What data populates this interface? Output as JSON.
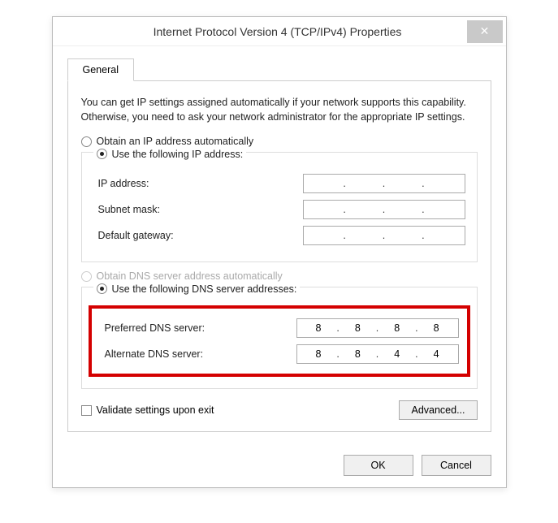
{
  "window": {
    "title": "Internet Protocol Version 4 (TCP/IPv4) Properties",
    "close_icon": "✕"
  },
  "tab": {
    "label": "General"
  },
  "info": "You can get IP settings assigned automatically if your network supports this capability. Otherwise, you need to ask your network administrator for the appropriate IP settings.",
  "ip": {
    "auto_label": "Obtain an IP address automatically",
    "manual_label": "Use the following IP address:",
    "address_label": "IP address:",
    "mask_label": "Subnet mask:",
    "gateway_label": "Default gateway:",
    "address": [
      "",
      "",
      "",
      ""
    ],
    "mask": [
      "",
      "",
      "",
      ""
    ],
    "gateway": [
      "",
      "",
      "",
      ""
    ]
  },
  "dns": {
    "auto_label": "Obtain DNS server address automatically",
    "manual_label": "Use the following DNS server addresses:",
    "preferred_label": "Preferred DNS server:",
    "alternate_label": "Alternate DNS server:",
    "preferred": [
      "8",
      "8",
      "8",
      "8"
    ],
    "alternate": [
      "8",
      "8",
      "4",
      "4"
    ]
  },
  "validate_label": "Validate settings upon exit",
  "advanced_label": "Advanced...",
  "ok_label": "OK",
  "cancel_label": "Cancel"
}
